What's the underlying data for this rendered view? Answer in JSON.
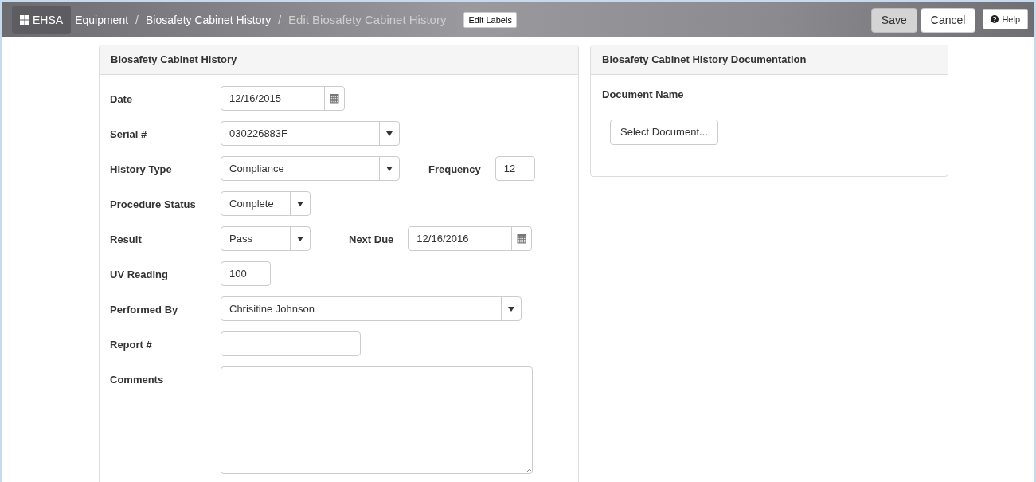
{
  "header": {
    "brand": "EHSA",
    "breadcrumbs": [
      {
        "label": "Equipment",
        "current": false
      },
      {
        "label": "Biosafety Cabinet History",
        "current": false
      },
      {
        "label": "Edit Biosafety Cabinet History",
        "current": true
      }
    ],
    "separator": "/",
    "edit_labels": "Edit Labels",
    "buttons": [
      {
        "label": "Save",
        "kind": "primary"
      },
      {
        "label": "Cancel",
        "kind": "default"
      },
      {
        "label": "Help",
        "kind": "help"
      }
    ]
  },
  "form_panel": {
    "title": "Biosafety Cabinet History",
    "rows": [
      {
        "label": "Date",
        "kind": "date",
        "value": "12/16/2015"
      },
      {
        "label": "Serial #",
        "kind": "select",
        "value": "030226883F"
      },
      {
        "label": "History Type",
        "kind": "select",
        "value": "Compliance",
        "extra": {
          "label": "Frequency",
          "kind": "text",
          "value": "12"
        }
      },
      {
        "label": "Procedure Status",
        "kind": "select",
        "value": "Complete"
      },
      {
        "label": "Result",
        "kind": "select",
        "value": "Pass",
        "extra": {
          "label": "Next Due",
          "kind": "date",
          "value": "12/16/2016"
        }
      },
      {
        "label": "UV Reading",
        "kind": "text",
        "value": "100"
      },
      {
        "label": "Performed By",
        "kind": "select",
        "value": "Chrisitine Johnson"
      },
      {
        "label": "Report #",
        "kind": "text"
      },
      {
        "label": "Comments",
        "kind": "textarea"
      }
    ]
  },
  "docs_panel": {
    "title": "Biosafety Cabinet History Documentation",
    "column": "Document Name",
    "select_button": "Select Document..."
  }
}
